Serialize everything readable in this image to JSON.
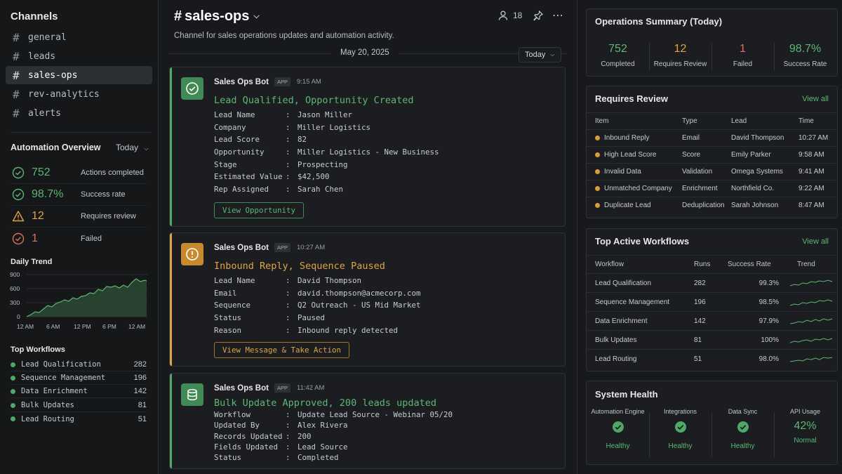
{
  "sidebar": {
    "title": "Channels",
    "channels": [
      {
        "name": "general"
      },
      {
        "name": "leads"
      },
      {
        "name": "sales-ops"
      },
      {
        "name": "rev-analytics"
      },
      {
        "name": "alerts"
      }
    ],
    "active_channel": "sales-ops",
    "automation": {
      "title": "Automation Overview",
      "period": "Today",
      "stats": [
        {
          "value": "752",
          "label": "Actions completed",
          "color": "#5cb874",
          "icon": "check-circle-icon"
        },
        {
          "value": "98.7%",
          "label": "Success rate",
          "color": "#5cb874",
          "icon": "check-circle-icon"
        },
        {
          "value": "12",
          "label": "Requires review",
          "color": "#e0a445",
          "icon": "warning-icon"
        },
        {
          "value": "1",
          "label": "Failed",
          "color": "#e0705c",
          "icon": "check-circle-icon"
        }
      ]
    },
    "daily_trend": {
      "title": "Daily Trend",
      "y_ticks": [
        "900",
        "600",
        "300",
        "0"
      ],
      "x_ticks": [
        "12 AM",
        "6 AM",
        "12 PM",
        "6 PM",
        "12 AM"
      ]
    },
    "top_workflows": {
      "title": "Top Workflows",
      "items": [
        {
          "name": "Lead Qualification",
          "count": "282"
        },
        {
          "name": "Sequence Management",
          "count": "196"
        },
        {
          "name": "Data Enrichment",
          "count": "142"
        },
        {
          "name": "Bulk Updates",
          "count": "81"
        },
        {
          "name": "Lead Routing",
          "count": "51"
        }
      ]
    }
  },
  "channel": {
    "hash": "#",
    "name": "sales-ops",
    "description": "Channel for sales operations updates and automation activity.",
    "members": "18",
    "date": "May 20, 2025",
    "date_filter": "Today"
  },
  "messages": [
    {
      "author": "Sales Ops Bot",
      "badge": "APP",
      "time": "9:15 AM",
      "icon": "check-circle-icon",
      "accent": "#4fa867",
      "headline": "Lead Qualified, Opportunity Created",
      "fields": [
        {
          "key": "Lead Name",
          "value": "Jason Miller"
        },
        {
          "key": "Company",
          "value": "Miller Logistics"
        },
        {
          "key": "Lead Score",
          "value": "82"
        },
        {
          "key": "Opportunity",
          "value": "Miller Logistics - New Business"
        },
        {
          "key": "Stage",
          "value": "Prospecting"
        },
        {
          "key": "Estimated Value",
          "value": "$42,500"
        },
        {
          "key": "Rep Assigned",
          "value": "Sarah Chen"
        }
      ],
      "action": "View Opportunity"
    },
    {
      "author": "Sales Ops Bot",
      "badge": "APP",
      "time": "10:27 AM",
      "icon": "alert-icon",
      "accent": "#e0a445",
      "headline": "Inbound Reply, Sequence Paused",
      "fields": [
        {
          "key": "Lead Name",
          "value": "David Thompson"
        },
        {
          "key": "Email",
          "value": "david.thompson@acmecorp.com"
        },
        {
          "key": "Sequence",
          "value": "Q2 Outreach - US Mid Market"
        },
        {
          "key": "Status",
          "value": "Paused"
        },
        {
          "key": "Reason",
          "value": "Inbound reply detected"
        }
      ],
      "action": "View Message & Take Action"
    },
    {
      "author": "Sales Ops Bot",
      "badge": "APP",
      "time": "11:42 AM",
      "icon": "database-icon",
      "accent": "#4fa867",
      "headline": "Bulk Update Approved, 200 leads updated",
      "fields": [
        {
          "key": "Workflow",
          "value": "Update Lead Source - Webinar 05/20"
        },
        {
          "key": "Updated By",
          "value": "Alex Rivera"
        },
        {
          "key": "Records Updated",
          "value": "200"
        },
        {
          "key": "Fields Updated",
          "value": "Lead Source"
        },
        {
          "key": "Status",
          "value": "Completed"
        }
      ]
    }
  ],
  "summary": {
    "title": "Operations Summary (Today)",
    "cells": [
      {
        "value": "752",
        "label": "Completed",
        "color": "#5cb874"
      },
      {
        "value": "12",
        "label": "Requires Review",
        "color": "#e0a445"
      },
      {
        "value": "1",
        "label": "Failed",
        "color": "#e0705c"
      },
      {
        "value": "98.7%",
        "label": "Success Rate",
        "color": "#5cb874"
      }
    ]
  },
  "requires_review": {
    "title": "Requires Review",
    "view_all": "View all",
    "columns": [
      "Item",
      "Type",
      "Lead",
      "Time"
    ],
    "rows": [
      {
        "item": "Inbound Reply",
        "type": "Email",
        "lead": "David Thompson",
        "time": "10:27 AM"
      },
      {
        "item": "High Lead Score",
        "type": "Score",
        "lead": "Emily Parker",
        "time": "9:58 AM"
      },
      {
        "item": "Invalid Data",
        "type": "Validation",
        "lead": "Omega Systems",
        "time": "9:41 AM"
      },
      {
        "item": "Unmatched Company",
        "type": "Enrichment",
        "lead": "Northfield Co.",
        "time": "9:22 AM"
      },
      {
        "item": "Duplicate Lead",
        "type": "Deduplication",
        "lead": "Sarah Johnson",
        "time": "8:47 AM"
      }
    ]
  },
  "top_active": {
    "title": "Top Active Workflows",
    "view_all": "View all",
    "columns": [
      "Workflow",
      "Runs",
      "Success Rate",
      "Trend"
    ],
    "rows": [
      {
        "name": "Lead Qualification",
        "runs": "282",
        "rate": "99.3%"
      },
      {
        "name": "Sequence Management",
        "runs": "196",
        "rate": "98.5%"
      },
      {
        "name": "Data Enrichment",
        "runs": "142",
        "rate": "97.9%"
      },
      {
        "name": "Bulk Updates",
        "runs": "81",
        "rate": "100%"
      },
      {
        "name": "Lead Routing",
        "runs": "51",
        "rate": "98.0%"
      }
    ]
  },
  "system_health": {
    "title": "System Health",
    "items": [
      {
        "name": "Automation Engine",
        "status": "Healthy",
        "icon": "check-circle-icon"
      },
      {
        "name": "Integrations",
        "status": "Healthy",
        "icon": "check-circle-icon"
      },
      {
        "name": "Data Sync",
        "status": "Healthy",
        "icon": "check-circle-icon"
      },
      {
        "name": "API Usage",
        "value": "42%",
        "status": "Normal"
      }
    ]
  }
}
